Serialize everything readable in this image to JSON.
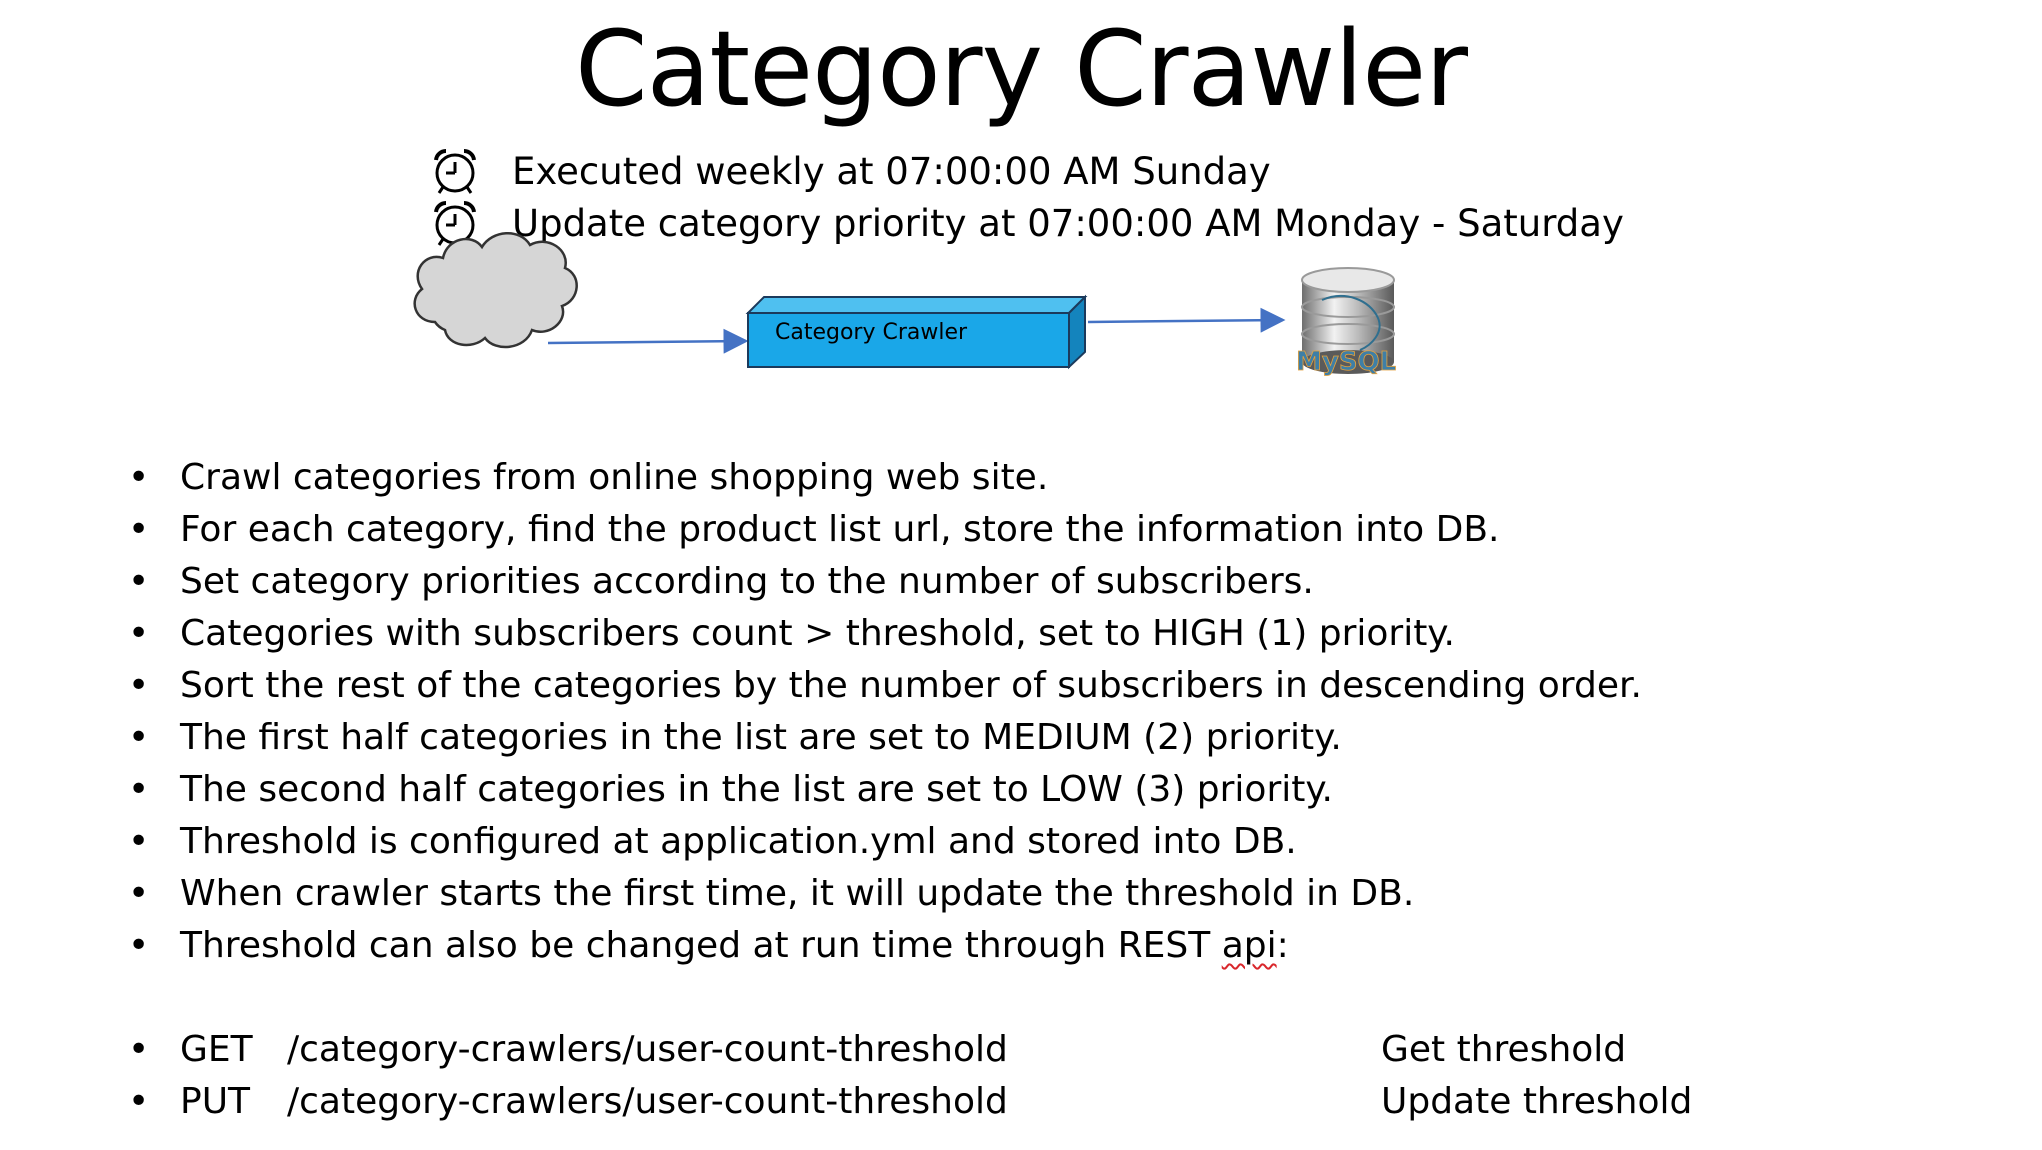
{
  "title": "Category Crawler",
  "schedule": [
    {
      "icon": "alarm-clock-icon",
      "text": "Executed weekly at 07:00:00 AM Sunday"
    },
    {
      "icon": "alarm-clock-icon",
      "text": "Update category priority at 07:00:00 AM Monday - Saturday"
    }
  ],
  "diagram": {
    "source_icon": "cloud-icon",
    "box_label": "Category Crawler",
    "box_color": "#1aa7e8",
    "target_icon": "mysql-database-icon",
    "target_label": "MySQL",
    "arrow_color": "#4472c4"
  },
  "bullets": [
    "Crawl categories from online shopping web site.",
    "For each category, find the product list url, store the information into DB.",
    "Set category priorities according to the number of subscribers.",
    "Categories with subscribers count > threshold, set to HIGH (1) priority.",
    "Sort the rest of the categories by the number of subscribers in descending order.",
    "The first half categories in the list are set to MEDIUM (2) priority.",
    "The second half categories in the list are set to LOW (3) priority.",
    "Threshold is configured at application.yml and stored into DB.",
    "When crawler starts the first time, it will update the threshold in DB.",
    "Threshold can also be changed at run time through REST"
  ],
  "bullet_last_suffix": "api",
  "bullet_last_colon": ":",
  "api": [
    {
      "method": "GET",
      "path": "/category-crawlers/user-count-threshold",
      "desc": "Get threshold"
    },
    {
      "method": "PUT",
      "path": "/category-crawlers/user-count-threshold",
      "desc": "Update threshold"
    }
  ],
  "bullet_symbol": "•"
}
